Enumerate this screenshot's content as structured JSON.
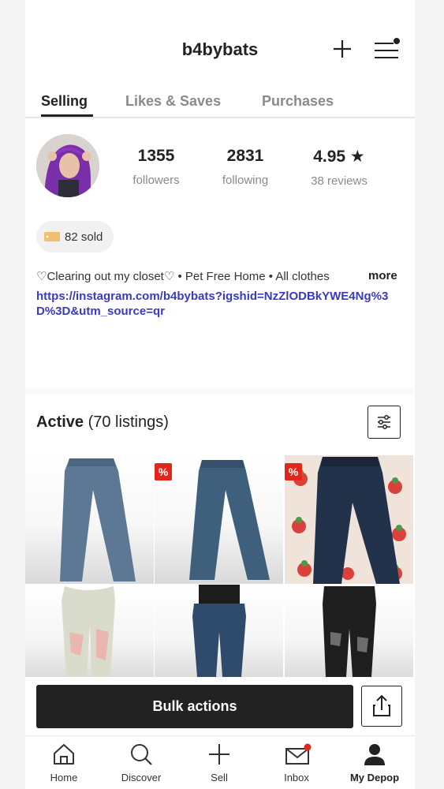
{
  "header": {
    "username": "b4bybats"
  },
  "tabs": [
    {
      "label": "Selling",
      "active": true
    },
    {
      "label": "Likes & Saves",
      "active": false
    },
    {
      "label": "Purchases",
      "active": false
    }
  ],
  "stats": {
    "followers": {
      "value": "1355",
      "label": "followers"
    },
    "following": {
      "value": "2831",
      "label": "following"
    },
    "rating": {
      "value": "4.95 ★",
      "label": "38 reviews"
    }
  },
  "sold": {
    "label": "82 sold"
  },
  "bio": {
    "text": "♡Clearing out my closet♡ • Pet Free Home • All clothes",
    "more_label": "more",
    "link": "https://instagram.com/b4bybats?igshid=NzZlODBkYWE4Ng%3D%3D&utm_source=qr"
  },
  "listings": {
    "title": "Active",
    "count": "(70 listings)",
    "items": [
      {
        "name": "light-wash-jeans",
        "sale": false
      },
      {
        "name": "medium-wash-jeans",
        "sale": true,
        "badge": "%"
      },
      {
        "name": "dark-jeans-strawberry-backdrop",
        "sale": true,
        "badge": "%"
      },
      {
        "name": "ripped-white-jeans",
        "sale": false
      },
      {
        "name": "blue-low-rise-jeans",
        "sale": false
      },
      {
        "name": "black-ripped-jeans",
        "sale": false
      }
    ]
  },
  "actions": {
    "bulk_label": "Bulk actions"
  },
  "nav": [
    {
      "label": "Home",
      "icon": "home-icon",
      "active": false
    },
    {
      "label": "Discover",
      "icon": "search-icon",
      "active": false
    },
    {
      "label": "Sell",
      "icon": "plus-icon",
      "active": false
    },
    {
      "label": "Inbox",
      "icon": "mail-icon",
      "active": false,
      "notification": true
    },
    {
      "label": "My Depop",
      "icon": "person-icon",
      "active": true
    }
  ],
  "colors": {
    "accent_link": "#3a3ac0",
    "sale_badge": "#e3261b",
    "notification_dot": "#e3261b"
  }
}
